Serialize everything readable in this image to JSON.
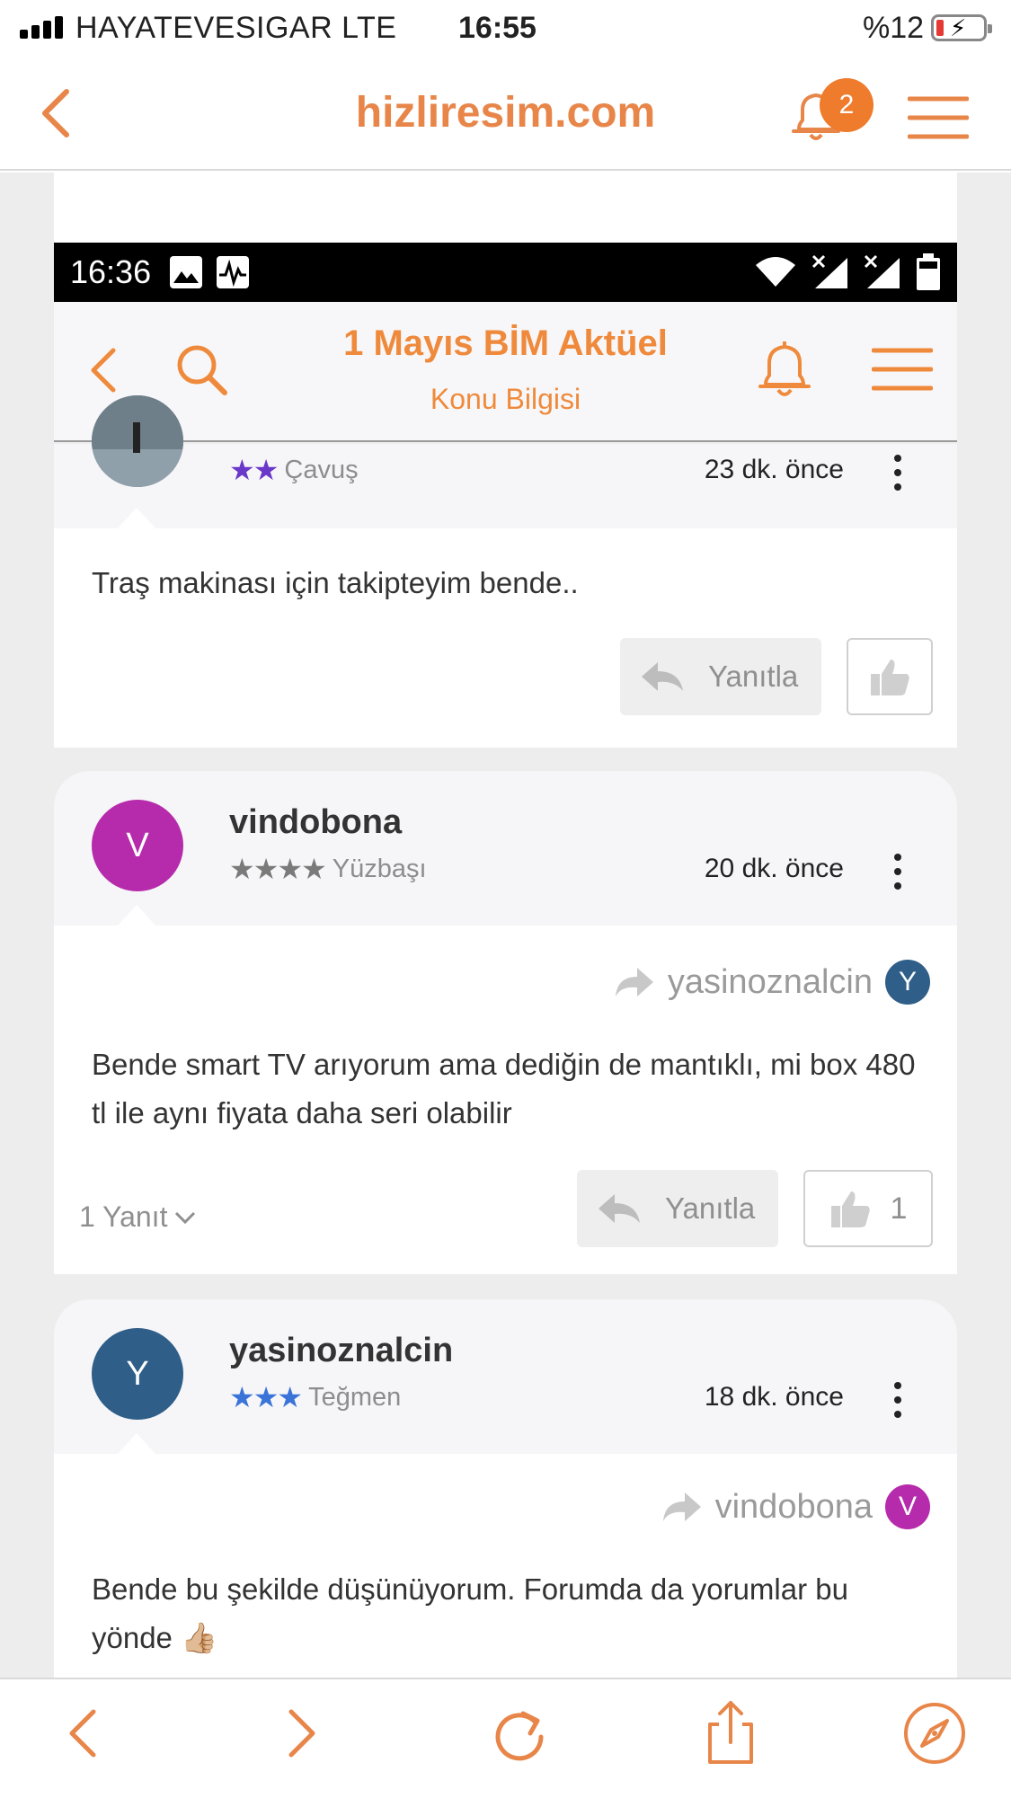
{
  "ios_status": {
    "carrier": "HAYATEVESIGAR  LTE",
    "time": "16:55",
    "battery": "%12"
  },
  "safari": {
    "site": "hizliresim.com",
    "notification_count": "2"
  },
  "android_status": {
    "time": "16:36"
  },
  "app_header": {
    "title": "1 Mayıs BİM Aktüel",
    "subtitle": "Konu Bilgisi"
  },
  "posts": [
    {
      "username": "",
      "rank": "Çavuş",
      "stars": "★★",
      "star_color": "#6a38c9",
      "time": "23 dk. önce",
      "text": "Traş makinası için takipteyim bende..",
      "reply_label": "Yanıtla",
      "like_count": ""
    },
    {
      "username": "vindobona",
      "avatar_letter": "V",
      "avatar_color": "#b62bab",
      "stars": "★★★★",
      "star_color": "#7a7a7a",
      "rank": "Yüzbaşı",
      "time": "20 dk. önce",
      "reply_to": "yasinoznalcin",
      "reply_to_letter": "Y",
      "reply_to_color": "#2f5e88",
      "text": "Bende smart TV arıyorum ama dediğin de mantıklı, mi box 480 tl ile aynı fiyata daha seri olabilir",
      "replies": "1 Yanıt",
      "reply_label": "Yanıtla",
      "like_count": "1"
    },
    {
      "username": "yasinoznalcin",
      "avatar_letter": "Y",
      "avatar_color": "#2f5e88",
      "stars": "★★★",
      "star_color": "#3a74d8",
      "rank": "Teğmen",
      "time": "18 dk. önce",
      "reply_to": "vindobona",
      "reply_to_letter": "V",
      "reply_to_color": "#b62bab",
      "text": "Bende bu şekilde düşünüyorum. Forumda da yorumlar bu yönde 👍🏼"
    }
  ],
  "colors": {
    "accent": "#ef8a3c",
    "safari_accent": "#e8864a"
  }
}
